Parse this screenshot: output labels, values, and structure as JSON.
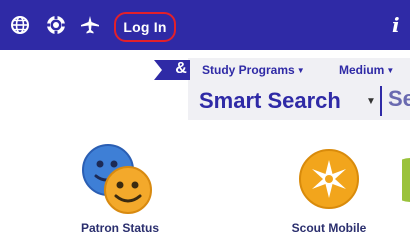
{
  "header": {
    "login_label": "Log In",
    "icons": [
      "globe-icon",
      "gear-badge-icon",
      "airplane-icon",
      "info-icon"
    ],
    "colors": {
      "bar": "#2f2aa6",
      "highlight": "#e3202a"
    }
  },
  "search": {
    "brand_mark": "&",
    "tabs": [
      {
        "label": "Study Programs"
      },
      {
        "label": "Medium"
      }
    ],
    "mode_label": "Smart Search",
    "input_partial": "Se"
  },
  "tiles": [
    {
      "label": "Patron Status",
      "icon": "smiley-faces-icon"
    },
    {
      "label": "Scout Mobile",
      "icon": "compass-star-icon"
    }
  ]
}
